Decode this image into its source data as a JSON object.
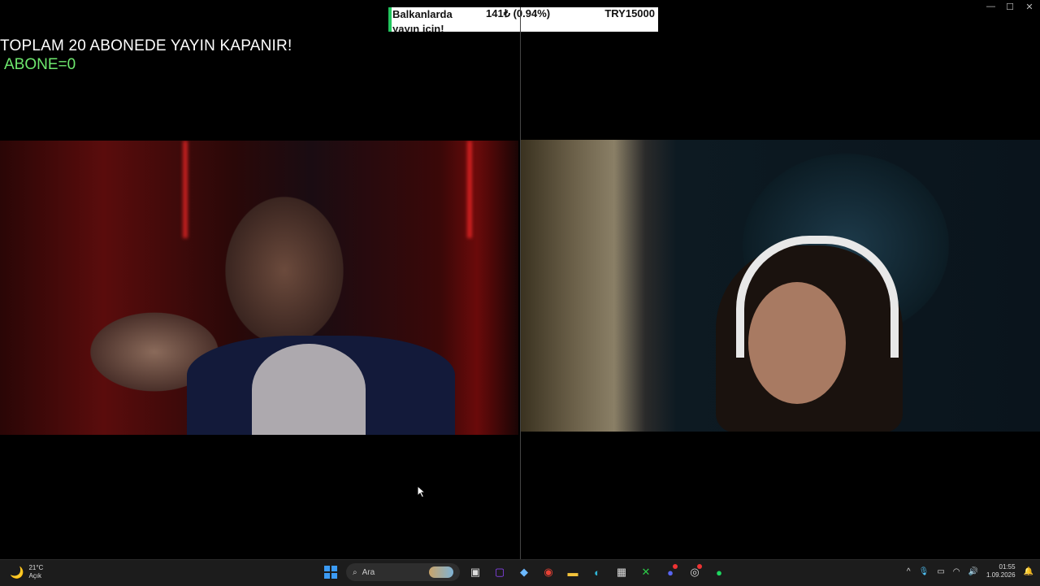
{
  "window_controls": {
    "minimize": "—",
    "maximize": "☐",
    "close": "✕"
  },
  "goal_widget": {
    "name_line1": "Balkanlarda",
    "name_line2": "yayın için!",
    "progress_text": "141₺ (0.94%)",
    "progress_fraction": 0.0094,
    "target_text": "TRY15000",
    "accent_color": "#22c55e"
  },
  "overlay": {
    "title": "TOPLAM 20 ABONEDE YAYIN KAPANIR!",
    "counter": "ABONE=0",
    "counter_color": "#6ee86e"
  },
  "taskbar": {
    "weather": {
      "temp": "21°C",
      "condition": "Açık",
      "icon": "moon-icon"
    },
    "search": {
      "placeholder": "Ara"
    },
    "apps": [
      {
        "name": "start",
        "icon": "windows-icon",
        "color": "#3b9bf5"
      },
      {
        "name": "task-view",
        "icon": "task-view-icon",
        "color": "#dddddd"
      },
      {
        "name": "twitch-app",
        "icon": "twitch-icon",
        "color": "#9146ff"
      },
      {
        "name": "copilot",
        "icon": "copilot-icon",
        "color": "#6bb8ff"
      },
      {
        "name": "chrome",
        "icon": "chrome-icon",
        "color": "#e94235"
      },
      {
        "name": "file-explorer",
        "icon": "folder-icon",
        "color": "#f3c33b"
      },
      {
        "name": "edge",
        "icon": "edge-icon",
        "color": "#2fb5d6"
      },
      {
        "name": "microsoft-store",
        "icon": "store-icon",
        "color": "#dddddd"
      },
      {
        "name": "xbox",
        "icon": "xbox-icon",
        "color": "#2dcc48"
      },
      {
        "name": "discord",
        "icon": "discord-icon",
        "color": "#5865f2"
      },
      {
        "name": "obs",
        "icon": "obs-icon",
        "color": "#dddddd"
      },
      {
        "name": "spotify",
        "icon": "spotify-icon",
        "color": "#1ed760"
      }
    ],
    "tray": {
      "chevron": "^",
      "time": "01:55",
      "date": "1.09.2026"
    }
  }
}
